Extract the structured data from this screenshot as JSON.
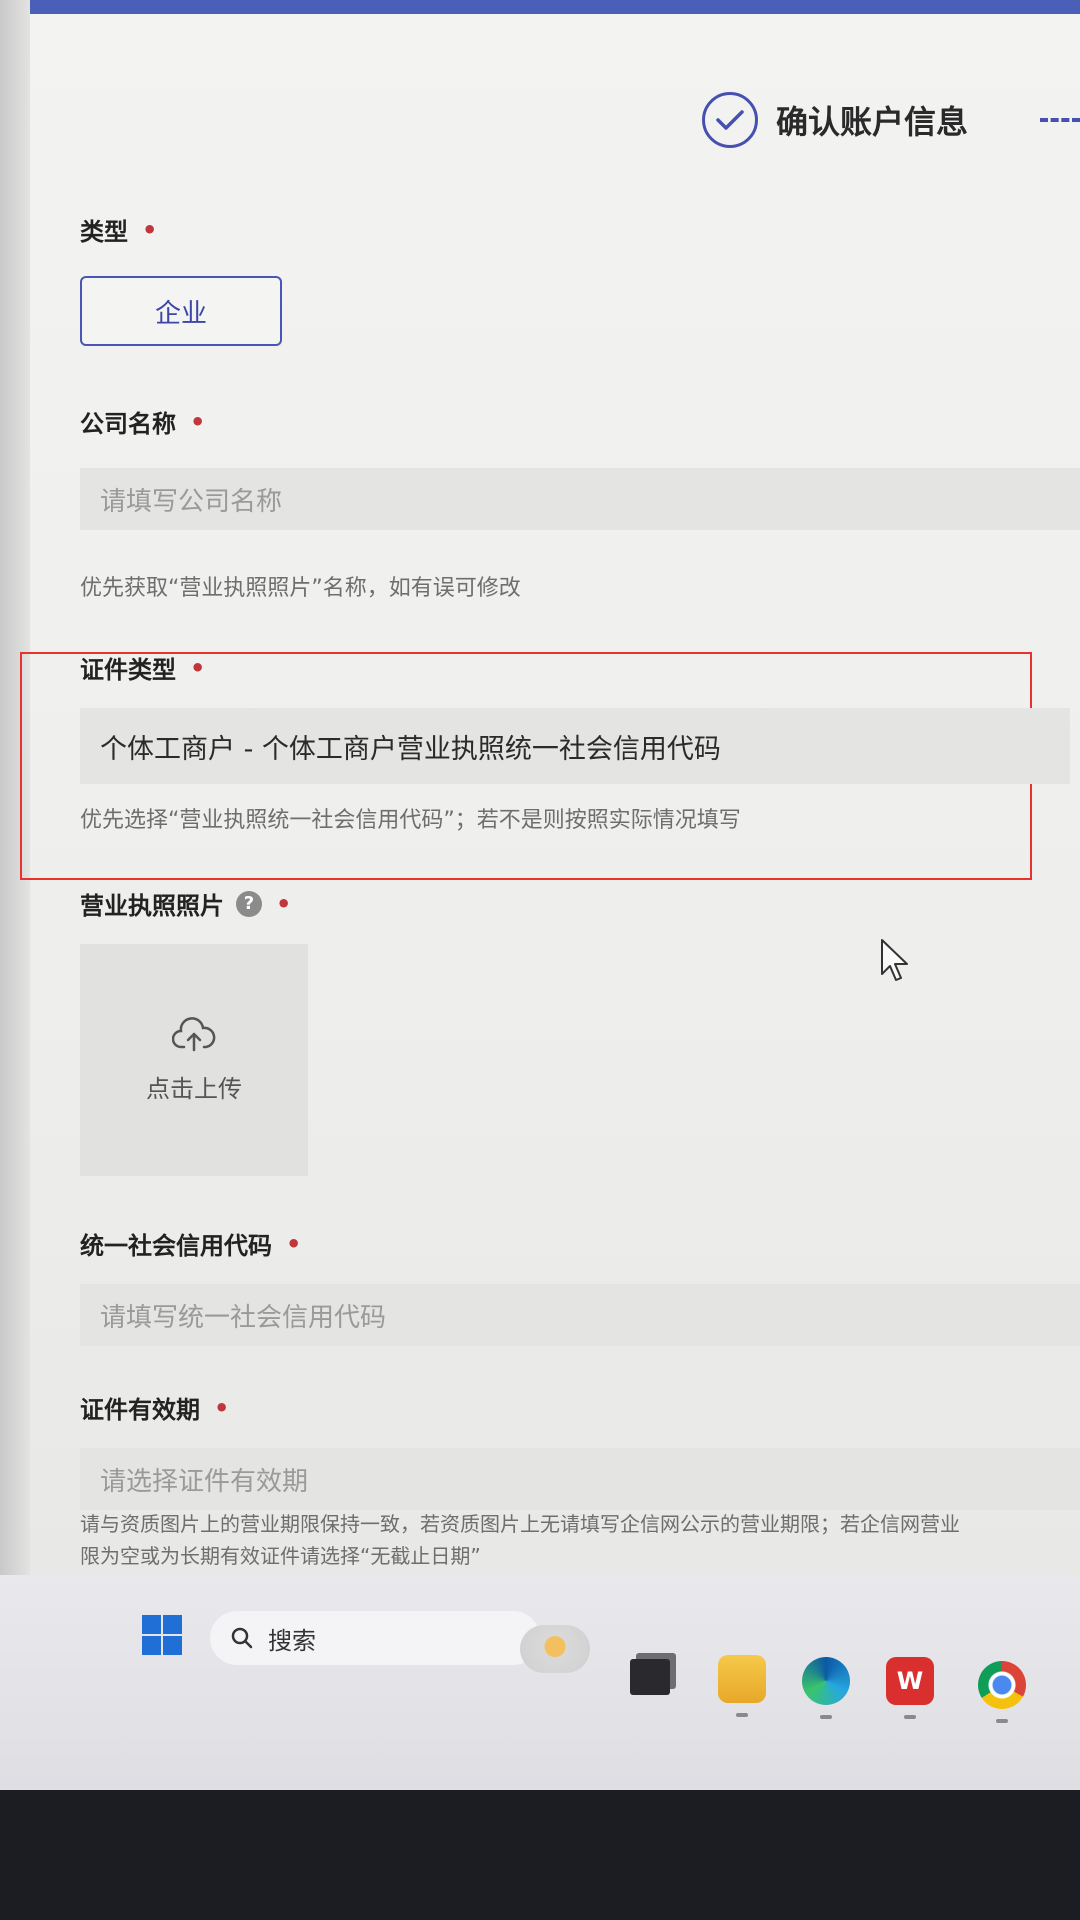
{
  "header": {
    "step_label": "确认账户信息"
  },
  "form": {
    "type": {
      "label": "类型",
      "required_mark": "•",
      "selected": "企业"
    },
    "company_name": {
      "label": "公司名称",
      "required_mark": "•",
      "placeholder": "请填写公司名称",
      "hint": "优先获取“营业执照照片”名称，如有误可修改"
    },
    "cert_type": {
      "label": "证件类型",
      "required_mark": "•",
      "value": "个体工商户 - 个体工商户营业执照统一社会信用代码",
      "hint": "优先选择“营业执照统一社会信用代码”；若不是则按照实际情况填写"
    },
    "license_photo": {
      "label": "营业执照照片",
      "help": "?",
      "required_mark": "•",
      "upload_text": "点击上传",
      "upload_icon": "cloud-upload-icon"
    },
    "credit_code": {
      "label": "统一社会信用代码",
      "required_mark": "•",
      "placeholder": "请填写统一社会信用代码"
    },
    "validity": {
      "label": "证件有效期",
      "required_mark": "•",
      "placeholder": "请选择证件有效期",
      "hint_line1": "请与资质图片上的营业期限保持一致，若资质图片上无请填写企信网公示的营业期限；若企信网营业",
      "hint_line2": "限为空或为长期有效证件请选择“无截止日期”"
    }
  },
  "taskbar": {
    "search_label": "搜索",
    "apps": [
      "widgets-icon",
      "task-view-icon",
      "file-explorer-icon",
      "edge-icon",
      "wps-icon",
      "chrome-icon"
    ]
  },
  "colors": {
    "accent": "#4650b0",
    "required": "#c0363a",
    "highlight_box": "#e8322e"
  }
}
